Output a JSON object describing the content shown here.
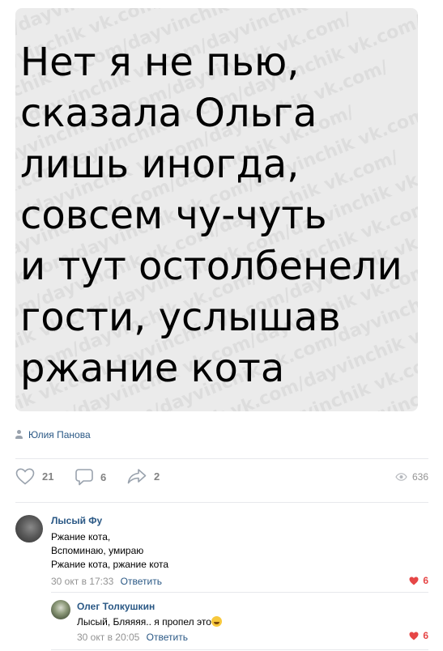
{
  "post": {
    "image": {
      "watermark": "dayvinchik vk.com/dayvinchik vk.com/dayvinchik vk.com/",
      "lines": [
        "Нет я не пью,",
        "сказала Ольга",
        "лишь иногда,",
        "совсем чу-чуть",
        "и тут остолбенели",
        "гости, услышав",
        "ржание кота"
      ]
    },
    "author": "Юлия Панова",
    "likes": "21",
    "comments": "6",
    "shares": "2",
    "views": "636"
  },
  "comments": [
    {
      "name": "Лысый Фу",
      "lines": [
        "Ржание кота,",
        "Вспоминаю, умираю",
        "Ржание кота, ржание кота"
      ],
      "date": "30 окт в 17:33",
      "reply_label": "Ответить",
      "likes": "6"
    },
    {
      "name": "Олег Толкушкин",
      "text": "Лысый, Бляяяя.. я пропел это",
      "emoji": "grinning-squinting-face",
      "date": "30 окт в 20:05",
      "reply_label": "Ответить",
      "likes": "6"
    }
  ],
  "colors": {
    "link": "#2a5885",
    "muted": "#939393",
    "like": "#e64646",
    "image_bg": "#ebebeb"
  }
}
